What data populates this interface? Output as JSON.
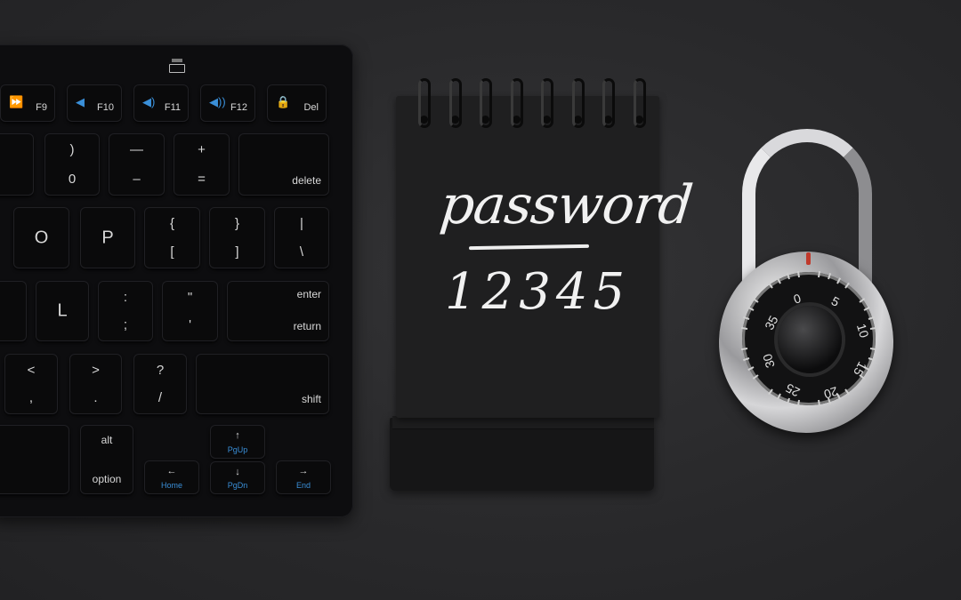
{
  "keyboard": {
    "keys": [
      {
        "name": "key-f9",
        "icon": "fast-forward-icon",
        "glyph": "⏩",
        "label": "F9"
      },
      {
        "name": "key-f10",
        "icon": "volume-mute-icon",
        "glyph": "◀",
        "label": "F10"
      },
      {
        "name": "key-f11",
        "icon": "volume-down-icon",
        "glyph": "◀)",
        "label": "F11"
      },
      {
        "name": "key-f12",
        "icon": "volume-up-icon",
        "glyph": "◀))",
        "label": "F12"
      },
      {
        "name": "key-del",
        "icon": "lock-icon",
        "glyph": "🔒",
        "label": "Del"
      },
      {
        "name": "key-partial",
        "top": "",
        "bottom": ""
      },
      {
        "name": "key-0",
        "top": ")",
        "bottom": "0"
      },
      {
        "name": "key-minus",
        "top": "—",
        "bottom": "–"
      },
      {
        "name": "key-equals",
        "top": "+",
        "bottom": "="
      },
      {
        "name": "key-delete",
        "label": "delete"
      },
      {
        "name": "key-o",
        "center": "O"
      },
      {
        "name": "key-p",
        "center": "P"
      },
      {
        "name": "key-bracket-left",
        "top": "{",
        "bottom": "["
      },
      {
        "name": "key-bracket-right",
        "top": "}",
        "bottom": "]"
      },
      {
        "name": "key-backslash",
        "top": "|",
        "bottom": "\\"
      },
      {
        "name": "key-partial",
        "top": "",
        "bottom": ""
      },
      {
        "name": "key-l",
        "center": "L"
      },
      {
        "name": "key-semicolon",
        "top": ":",
        "bottom": ";"
      },
      {
        "name": "key-quote",
        "top": "\"",
        "bottom": "'"
      },
      {
        "name": "key-enter",
        "label_top": "enter",
        "label": "return"
      },
      {
        "name": "key-comma",
        "top": "<",
        "bottom": ","
      },
      {
        "name": "key-period",
        "top": ">",
        "bottom": "."
      },
      {
        "name": "key-slash",
        "top": "?",
        "bottom": "/"
      },
      {
        "name": "key-shift",
        "label": "shift"
      },
      {
        "name": "key-partial",
        "top": "",
        "bottom": ""
      },
      {
        "name": "key-alt",
        "top": "alt",
        "bottom": "option"
      },
      {
        "name": "key-home",
        "arrow": "←",
        "blue": "Home"
      },
      {
        "name": "key-pgup",
        "arrow": "↑",
        "blue": "PgUp"
      },
      {
        "name": "key-pgdn",
        "arrow": "↓",
        "blue": "PgDn"
      },
      {
        "name": "key-end",
        "arrow": "→",
        "blue": "End"
      }
    ],
    "accent_color": "#3a8fd8"
  },
  "notepad": {
    "word": "password",
    "number": "12345"
  },
  "padlock": {
    "dial_numbers": [
      "0",
      "5",
      "10",
      "15",
      "20",
      "25",
      "30",
      "35"
    ],
    "marker_color": "#c0392b"
  }
}
